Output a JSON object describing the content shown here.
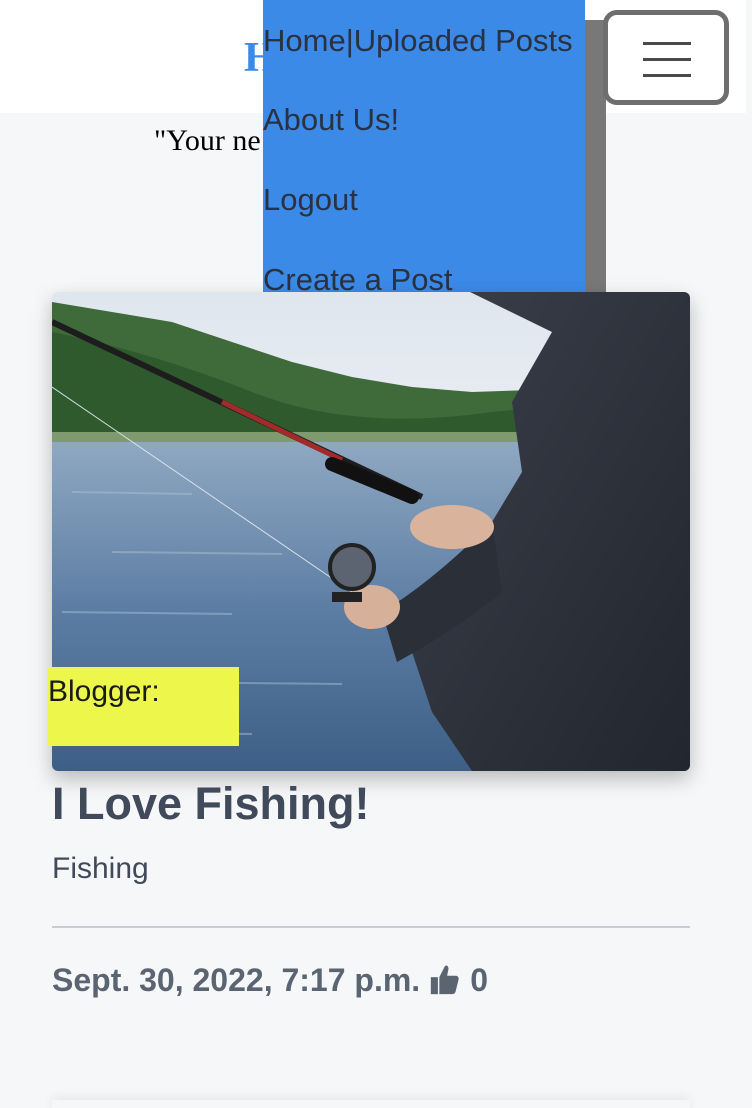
{
  "header": {
    "site_title": "H",
    "tagline": "\"Your ne"
  },
  "nav": {
    "items": [
      {
        "label": "Home|Uploaded Posts"
      },
      {
        "label": "About Us!"
      },
      {
        "label": "Logout"
      },
      {
        "label": "Create a Post"
      }
    ]
  },
  "post": {
    "blogger_label": "Blogger:",
    "title": "I Love Fishing!",
    "category": "Fishing",
    "date": "Sept. 30, 2022, 7:17 p.m.",
    "likes": "0",
    "image_icon": "fishing-photo"
  },
  "colors": {
    "accent": "#3b8ae8",
    "badge": "#edf74b",
    "background": "#f6f7f9"
  }
}
